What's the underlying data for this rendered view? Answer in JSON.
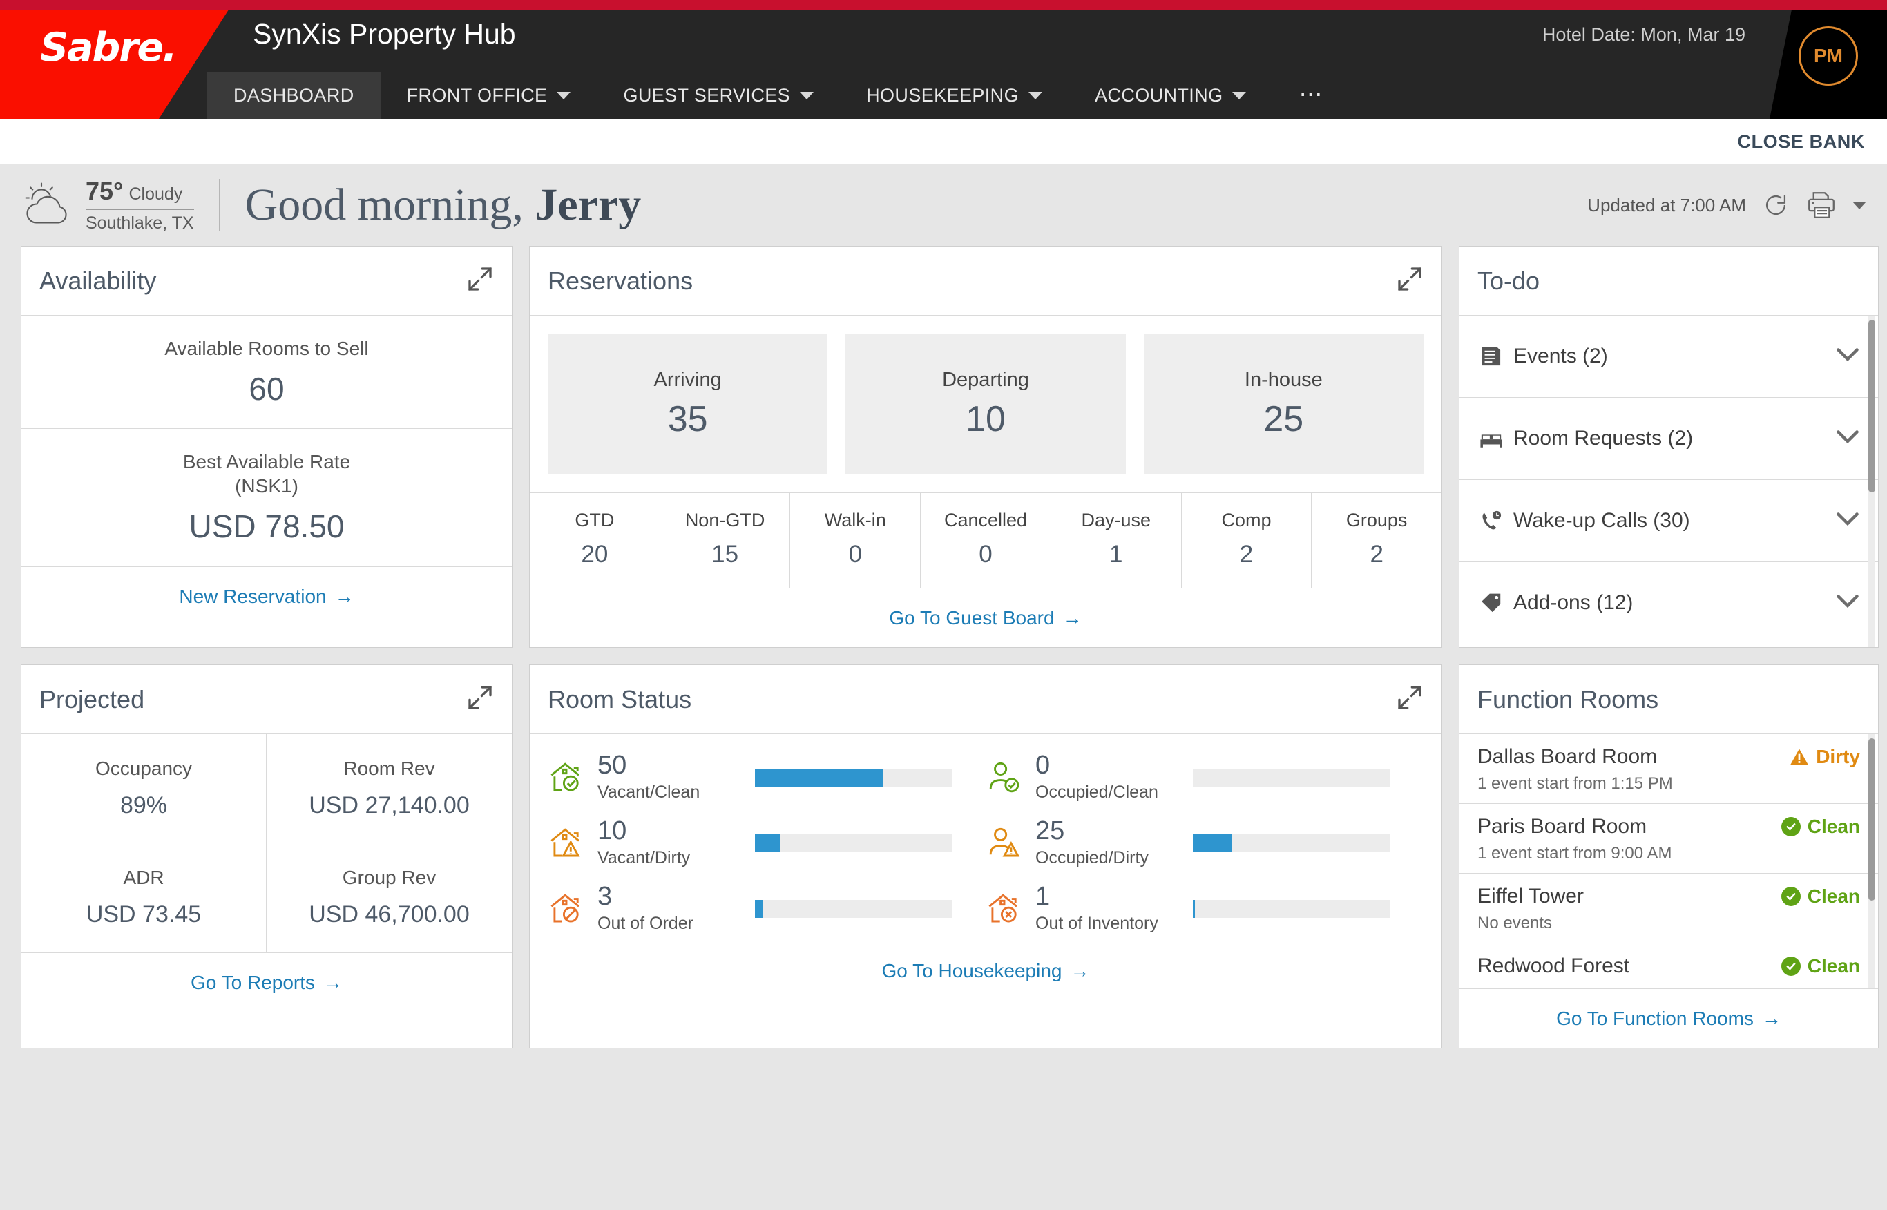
{
  "header": {
    "brand": "Sabre.",
    "app_title": "SynXis Property Hub",
    "hotel_date": "Hotel Date: Mon, Mar 19",
    "avatar_initials": "PM",
    "nav": [
      {
        "label": "DASHBOARD",
        "has_caret": false,
        "active": true
      },
      {
        "label": "FRONT OFFICE",
        "has_caret": true,
        "active": false
      },
      {
        "label": "GUEST SERVICES",
        "has_caret": true,
        "active": false
      },
      {
        "label": "HOUSEKEEPING",
        "has_caret": true,
        "active": false
      },
      {
        "label": "ACCOUNTING",
        "has_caret": true,
        "active": false
      }
    ],
    "overflow_icon": "ellipsis-icon",
    "close_bank": "CLOSE BANK"
  },
  "greeting_bar": {
    "weather_icon": "sun-behind-cloud-icon",
    "temperature": "75°",
    "condition": "Cloudy",
    "location": "Southlake, TX",
    "greeting_prefix": "Good morning, ",
    "greeting_name": "Jerry",
    "updated": "Updated at 7:00 AM",
    "refresh_icon": "refresh-icon",
    "print_icon": "printer-icon",
    "print_caret_icon": "chevron-down-icon"
  },
  "availability": {
    "title": "Availability",
    "expand_icon": "expand-icon",
    "rows": [
      {
        "label": "Available Rooms to Sell",
        "value": "60"
      },
      {
        "label": "Best Available Rate\n(NSK1)",
        "value": "USD 78.50"
      }
    ],
    "rooms_label": "Available Rooms to Sell",
    "rooms_value": "60",
    "rate_label_1": "Best Available Rate",
    "rate_label_2": "(NSK1)",
    "rate_value": "USD 78.50",
    "footer_link": "New Reservation"
  },
  "reservations": {
    "title": "Reservations",
    "expand_icon": "expand-icon",
    "tiles": [
      {
        "label": "Arriving",
        "value": "35"
      },
      {
        "label": "Departing",
        "value": "10"
      },
      {
        "label": "In-house",
        "value": "25"
      }
    ],
    "stats": [
      {
        "label": "GTD",
        "value": "20"
      },
      {
        "label": "Non-GTD",
        "value": "15"
      },
      {
        "label": "Walk-in",
        "value": "0"
      },
      {
        "label": "Cancelled",
        "value": "0"
      },
      {
        "label": "Day-use",
        "value": "1"
      },
      {
        "label": "Comp",
        "value": "2"
      },
      {
        "label": "Groups",
        "value": "2"
      }
    ],
    "footer_link": "Go To Guest Board"
  },
  "todo": {
    "title": "To-do",
    "items": [
      {
        "label": "Events (2)",
        "icon": "agenda-list-icon"
      },
      {
        "label": "Room Requests (2)",
        "icon": "bed-icon"
      },
      {
        "label": "Wake-up Calls (30)",
        "icon": "phone-clock-icon"
      },
      {
        "label": "Add-ons (12)",
        "icon": "tag-icon"
      }
    ]
  },
  "projected": {
    "title": "Projected",
    "expand_icon": "expand-icon",
    "cells": [
      {
        "label": "Occupancy",
        "value": "89%"
      },
      {
        "label": "Room Rev",
        "value": "USD 27,140.00"
      },
      {
        "label": "ADR",
        "value": "USD 73.45"
      },
      {
        "label": "Group Rev",
        "value": "USD 46,700.00"
      }
    ],
    "footer_link": "Go To Reports"
  },
  "room_status": {
    "title": "Room Status",
    "expand_icon": "expand-icon",
    "items": [
      {
        "value": "50",
        "label": "Vacant/Clean",
        "pct": 65,
        "icon": "house-check-icon",
        "color": "#5fa315"
      },
      {
        "value": "0",
        "label": "Occupied/Clean",
        "pct": 0,
        "icon": "person-check-icon",
        "color": "#5fa315"
      },
      {
        "value": "10",
        "label": "Vacant/Dirty",
        "pct": 13,
        "icon": "house-warning-icon",
        "color": "#e08a12"
      },
      {
        "value": "25",
        "label": "Occupied/Dirty",
        "pct": 20,
        "icon": "person-warning-icon",
        "color": "#e08a12"
      },
      {
        "value": "3",
        "label": "Out of Order",
        "pct": 4,
        "icon": "house-blocked-icon",
        "color": "#e8722a"
      },
      {
        "value": "1",
        "label": "Out of Inventory",
        "pct": 1,
        "icon": "house-x-icon",
        "color": "#e8722a"
      }
    ],
    "footer_link": "Go To Housekeeping"
  },
  "function_rooms": {
    "title": "Function Rooms",
    "items": [
      {
        "name": "Dallas Board Room",
        "sub": "1 event start from 1:15 PM",
        "status": "Dirty",
        "status_type": "dirty"
      },
      {
        "name": "Paris Board Room",
        "sub": "1 event start from 9:00 AM",
        "status": "Clean",
        "status_type": "clean"
      },
      {
        "name": "Eiffel Tower",
        "sub": "No events",
        "status": "Clean",
        "status_type": "clean"
      },
      {
        "name": "Redwood Forest",
        "sub": "",
        "status": "Clean",
        "status_type": "clean"
      }
    ],
    "footer_link": "Go To Function Rooms"
  },
  "colors": {
    "brand_red": "#fa0f00",
    "accent_blue": "#1c7cb5",
    "bar_blue": "#2e95cf",
    "green": "#5fa315",
    "orange": "#e08a12",
    "slate": "#4e5a68"
  }
}
